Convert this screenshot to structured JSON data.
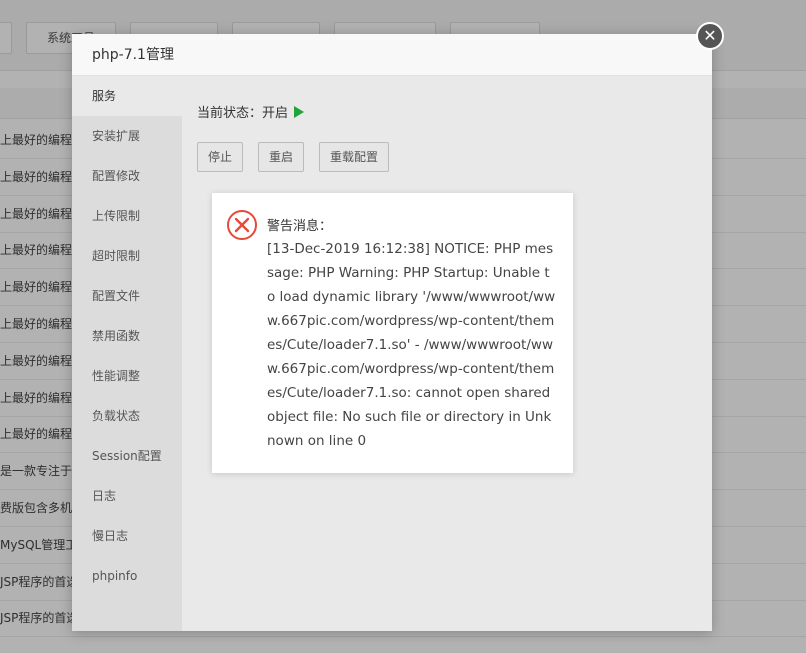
{
  "background": {
    "top_tabs": [
      "",
      "系统工具",
      "",
      "",
      "",
      ""
    ],
    "rows": [
      "上最好的编程语",
      "上最好的编程语",
      "上最好的编程语",
      "上最好的编程语",
      "上最好的编程语",
      "上最好的编程语",
      "上最好的编程语",
      "上最好的编程语",
      "上最好的编程语",
      "是一款专注于程",
      "费版包含多机",
      "MySQL管理工",
      "JSP程序的首选",
      "JSP程序的首选"
    ]
  },
  "modal": {
    "title": "php-7.1管理",
    "close_glyph": "✕",
    "sidebar": [
      "服务",
      "安装扩展",
      "配置修改",
      "上传限制",
      "超时限制",
      "配置文件",
      "禁用函数",
      "性能调整",
      "负载状态",
      "Session配置",
      "日志",
      "慢日志",
      "phpinfo"
    ],
    "status_label": "当前状态：开启",
    "buttons": {
      "stop": "停止",
      "restart": "重启",
      "reload": "重载配置"
    }
  },
  "alert": {
    "title": "警告消息：",
    "message": "[13-Dec-2019 16:12:38] NOTICE: PHP message: PHP Warning: PHP Startup: Unable to load dynamic library '/www/wwwroot/www.667pic.com/wordpress/wp-content/themes/Cute/loader7.1.so' - /www/wwwroot/www.667pic.com/wordpress/wp-content/themes/Cute/loader7.1.so: cannot open shared object file: No such file or directory in Unknown on line 0",
    "icon_color": "#e64a3a"
  },
  "colors": {
    "accent": "#20a53a"
  }
}
